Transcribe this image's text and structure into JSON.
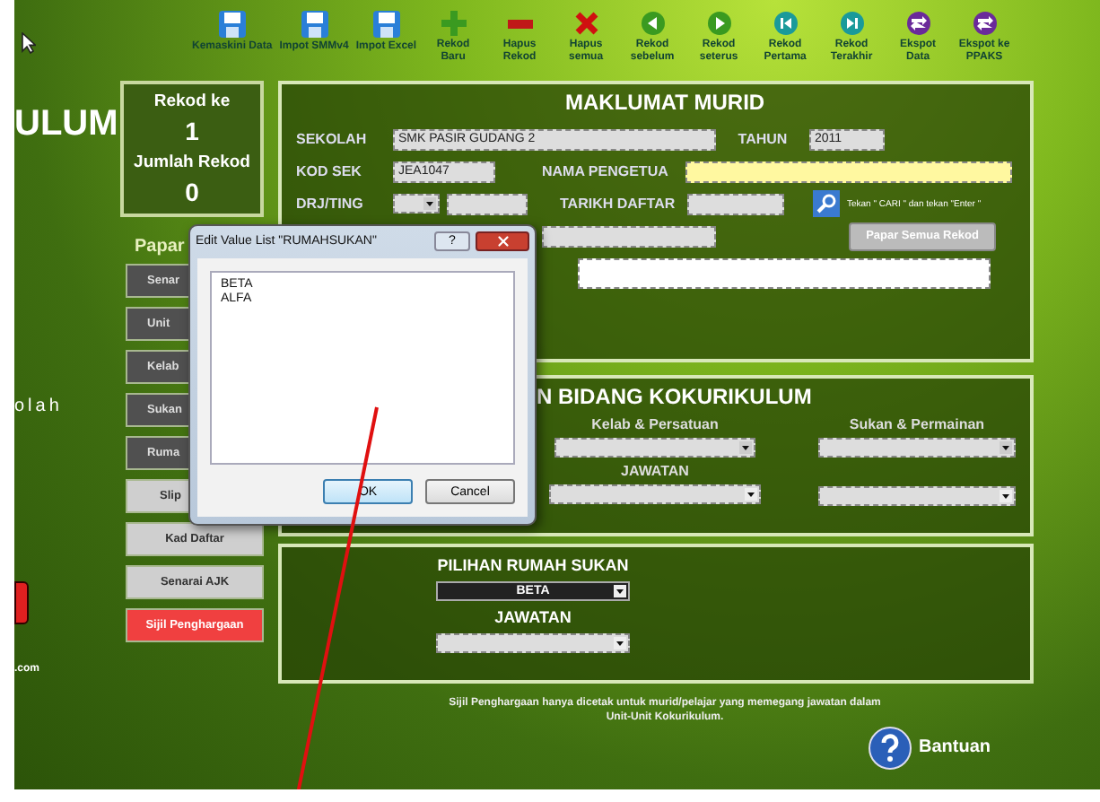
{
  "toolbar": [
    "Kemaskini Data",
    "Impot SMMv4",
    "Impot Excel",
    "Rekod Baru",
    "Hapus Rekod",
    "Hapus semua",
    "Rekod sebelum",
    "Rekod seterus",
    "Rekod Pertama",
    "Rekod Terakhir",
    "Ekspot Data",
    "Ekspot ke PPAKS"
  ],
  "side": {
    "title": "ULUM",
    "subtitle": "olah",
    "footer": ".com"
  },
  "record": {
    "current_label": "Rekod ke",
    "current": "1",
    "total_label": "Jumlah Rekod",
    "total": "0"
  },
  "menu": {
    "heading": "Papar",
    "buttons": [
      {
        "label": "Senar",
        "kind": "dark"
      },
      {
        "label": "Unit",
        "kind": "dark"
      },
      {
        "label": "Kelab",
        "kind": "dark"
      },
      {
        "label": "Sukan",
        "kind": "dark"
      },
      {
        "label": "Ruma",
        "kind": "dark"
      },
      {
        "label": "Slip",
        "kind": "partial"
      },
      {
        "label": "Kad Daftar",
        "kind": "light"
      },
      {
        "label": "Senarai AJK",
        "kind": "light"
      },
      {
        "label": "Sijil Penghargaan",
        "kind": "alert"
      }
    ]
  },
  "student": {
    "title": "MAKLUMAT MURID",
    "school_label": "SEKOLAH",
    "school": "SMK PASIR GUDANG 2",
    "year_label": "TAHUN",
    "year": "2011",
    "code_label": "KOD SEK",
    "code": "JEA1047",
    "principal_label": "NAMA PENGETUA",
    "grade_label": "DRJ/TING",
    "date_label": "TARIKH DAFTAR",
    "hint": "Tekan \" CARI \" dan tekan \"Enter \"",
    "show_all_button": "Papar Semua Rekod"
  },
  "cocurricular": {
    "title": "N BIDANG KOKURIKULUM",
    "club_label": "Kelab & Persatuan",
    "sport_label": "Sukan & Permainan",
    "role_label": "JAWATAN"
  },
  "house": {
    "title": "PILIHAN RUMAH SUKAN",
    "value": "BETA",
    "role_label": "JAWATAN"
  },
  "note": [
    "Sijil Penghargaan hanya dicetak untuk murid/pelajar yang memegang jawatan dalam",
    "Unit-Unit Kokurikulum."
  ],
  "help": "Bantuan",
  "dialog": {
    "title": "Edit Value List \"RUMAHSUKAN\"",
    "help": "?",
    "items": [
      "BETA",
      "ALFA"
    ],
    "buttons": [
      {
        "label": "OK",
        "selected": true
      },
      {
        "label": "Cancel",
        "selected": false
      }
    ]
  }
}
